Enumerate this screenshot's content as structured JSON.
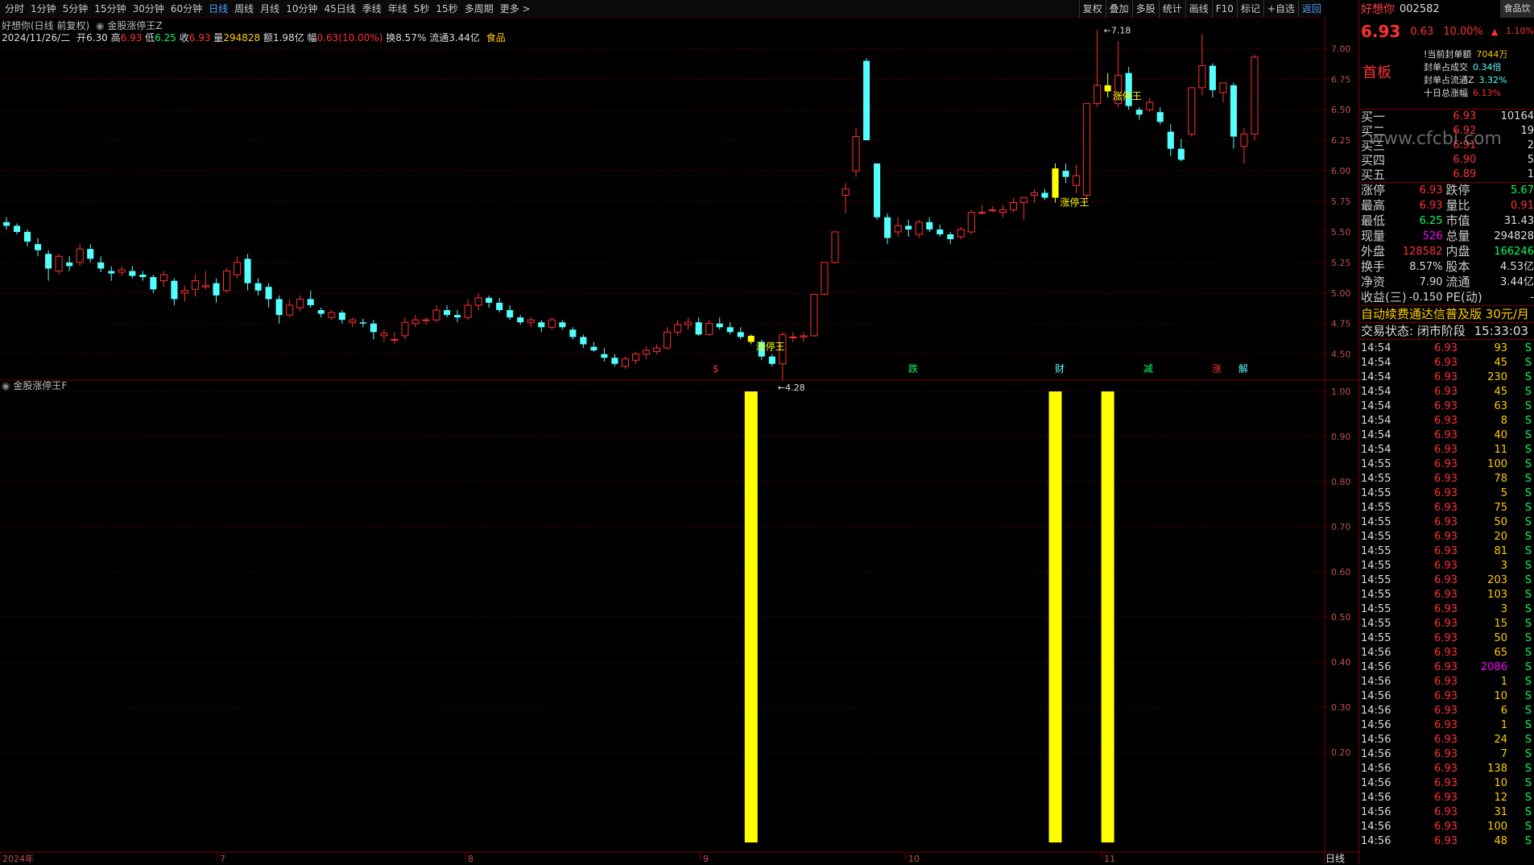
{
  "toolbar": {
    "periods": [
      "分时",
      "1分钟",
      "5分钟",
      "15分钟",
      "30分钟",
      "60分钟",
      "日线",
      "周线",
      "月线",
      "10分钟",
      "45日线",
      "季线",
      "年线",
      "5秒",
      "15秒",
      "多周期",
      "更多 >"
    ],
    "active": "日线",
    "tools": [
      "复权",
      "叠加",
      "多股",
      "统计",
      "画线",
      "F10",
      "标记",
      "+自选",
      "返回"
    ]
  },
  "header": {
    "title_line": "好想你(日线 前复权)",
    "indicator_main": "金股涨停王Z",
    "date": "2024/11/26/二",
    "open_label": "开",
    "open": "6.30",
    "high_label": "高",
    "high": "6.93",
    "low_label": "低",
    "low": "6.25",
    "close_label": "收",
    "close": "6.93",
    "vol_label": "量",
    "vol": "294828",
    "amt_label": "额",
    "amt": "1.98亿",
    "chg_label": "幅",
    "chg": "0.63(10.00%)",
    "turn_label": "换",
    "turn": "8.57%",
    "float_label": "流通",
    "float": "3.44亿",
    "sector": "食品"
  },
  "sub_indicator": "金股涨停王F",
  "colors": {
    "up": "#ff3030",
    "down": "#54ffff",
    "signal": "#ffff00",
    "grid": "#5a0000",
    "bg": "#000000"
  },
  "chart_data": {
    "type": "candlestick",
    "ylim": [
      4.3,
      7.2
    ],
    "yticks": [
      "7.00",
      "6.75",
      "6.50",
      "6.25",
      "6.00",
      "5.75",
      "5.50",
      "5.25",
      "5.00",
      "4.75",
      "4.50"
    ],
    "x_labels": [
      "2024年",
      "7",
      "8",
      "9",
      "10",
      "11"
    ],
    "annotations": {
      "high_mark": "7.18",
      "low_mark": "4.28",
      "signal_label": "涨停王"
    },
    "event_labels": [
      "$",
      "跌",
      "财",
      "减",
      "涨",
      "解"
    ],
    "candles": [
      [
        5.58,
        5.62,
        5.52,
        5.55
      ],
      [
        5.55,
        5.57,
        5.48,
        5.5
      ],
      [
        5.5,
        5.52,
        5.38,
        5.42
      ],
      [
        5.4,
        5.45,
        5.3,
        5.35
      ],
      [
        5.32,
        5.35,
        5.1,
        5.2
      ],
      [
        5.18,
        5.32,
        5.15,
        5.3
      ],
      [
        5.25,
        5.3,
        5.18,
        5.22
      ],
      [
        5.25,
        5.4,
        5.22,
        5.36
      ],
      [
        5.36,
        5.4,
        5.25,
        5.28
      ],
      [
        5.25,
        5.3,
        5.17,
        5.2
      ],
      [
        5.18,
        5.22,
        5.1,
        5.16
      ],
      [
        5.17,
        5.22,
        5.14,
        5.19
      ],
      [
        5.18,
        5.22,
        5.12,
        5.14
      ],
      [
        5.15,
        5.18,
        5.1,
        5.13
      ],
      [
        5.13,
        5.15,
        5.0,
        5.03
      ],
      [
        5.1,
        5.18,
        5.05,
        5.15
      ],
      [
        5.1,
        5.12,
        4.9,
        4.95
      ],
      [
        5.0,
        5.06,
        4.93,
        5.02
      ],
      [
        5.03,
        5.15,
        4.97,
        5.1
      ],
      [
        5.05,
        5.18,
        5.03,
        5.06
      ],
      [
        5.08,
        5.12,
        4.92,
        4.98
      ],
      [
        5.02,
        5.2,
        5.0,
        5.18
      ],
      [
        5.15,
        5.3,
        5.12,
        5.25
      ],
      [
        5.28,
        5.32,
        5.02,
        5.08
      ],
      [
        5.08,
        5.12,
        4.98,
        5.02
      ],
      [
        5.05,
        5.08,
        4.88,
        4.95
      ],
      [
        4.95,
        4.98,
        4.75,
        4.82
      ],
      [
        4.82,
        4.95,
        4.8,
        4.9
      ],
      [
        4.88,
        4.98,
        4.85,
        4.95
      ],
      [
        4.95,
        5.02,
        4.88,
        4.9
      ],
      [
        4.86,
        4.88,
        4.8,
        4.83
      ],
      [
        4.8,
        4.86,
        4.78,
        4.84
      ],
      [
        4.84,
        4.86,
        4.75,
        4.78
      ],
      [
        4.76,
        4.8,
        4.72,
        4.78
      ],
      [
        4.76,
        4.79,
        4.72,
        4.75
      ],
      [
        4.75,
        4.78,
        4.62,
        4.68
      ],
      [
        4.65,
        4.7,
        4.6,
        4.67
      ],
      [
        4.62,
        4.68,
        4.58,
        4.62
      ],
      [
        4.65,
        4.8,
        4.62,
        4.76
      ],
      [
        4.75,
        4.82,
        4.72,
        4.78
      ],
      [
        4.78,
        4.8,
        4.74,
        4.78
      ],
      [
        4.78,
        4.9,
        4.76,
        4.86
      ],
      [
        4.86,
        4.9,
        4.8,
        4.82
      ],
      [
        4.82,
        4.86,
        4.76,
        4.8
      ],
      [
        4.8,
        4.95,
        4.78,
        4.9
      ],
      [
        4.9,
        5.0,
        4.86,
        4.96
      ],
      [
        4.96,
        4.98,
        4.88,
        4.92
      ],
      [
        4.92,
        4.96,
        4.84,
        4.86
      ],
      [
        4.86,
        4.9,
        4.78,
        4.8
      ],
      [
        4.8,
        4.82,
        4.74,
        4.76
      ],
      [
        4.76,
        4.8,
        4.72,
        4.78
      ],
      [
        4.76,
        4.78,
        4.68,
        4.72
      ],
      [
        4.72,
        4.8,
        4.7,
        4.78
      ],
      [
        4.76,
        4.78,
        4.7,
        4.72
      ],
      [
        4.7,
        4.72,
        4.62,
        4.64
      ],
      [
        4.64,
        4.66,
        4.55,
        4.58
      ],
      [
        4.56,
        4.6,
        4.52,
        4.53
      ],
      [
        4.5,
        4.55,
        4.44,
        4.47
      ],
      [
        4.47,
        4.5,
        4.4,
        4.42
      ],
      [
        4.4,
        4.48,
        4.38,
        4.46
      ],
      [
        4.45,
        4.52,
        4.42,
        4.5
      ],
      [
        4.5,
        4.56,
        4.46,
        4.53
      ],
      [
        4.52,
        4.58,
        4.5,
        4.55
      ],
      [
        4.55,
        4.72,
        4.54,
        4.68
      ],
      [
        4.68,
        4.78,
        4.65,
        4.74
      ],
      [
        4.74,
        4.8,
        4.7,
        4.76
      ],
      [
        4.76,
        4.8,
        4.65,
        4.66
      ],
      [
        4.66,
        4.78,
        4.65,
        4.75
      ],
      [
        4.75,
        4.8,
        4.7,
        4.72
      ],
      [
        4.72,
        4.76,
        4.66,
        4.68
      ],
      [
        4.68,
        4.72,
        4.62,
        4.64
      ],
      [
        4.65,
        4.66,
        4.58,
        4.6
      ],
      [
        4.6,
        4.62,
        4.45,
        4.48
      ],
      [
        4.48,
        4.5,
        4.4,
        4.42
      ],
      [
        4.42,
        4.68,
        4.28,
        4.66
      ],
      [
        4.64,
        4.68,
        4.6,
        4.64
      ],
      [
        4.64,
        4.68,
        4.6,
        4.65
      ],
      [
        4.65,
        4.99,
        4.64,
        4.99
      ],
      [
        4.99,
        5.25,
        4.98,
        5.25
      ],
      [
        5.25,
        5.5,
        5.24,
        5.5
      ],
      [
        5.8,
        5.9,
        5.65,
        5.85
      ],
      [
        6.0,
        6.35,
        5.95,
        6.28
      ],
      [
        6.9,
        6.92,
        6.25,
        6.25
      ],
      [
        6.06,
        6.06,
        5.6,
        5.62
      ],
      [
        5.62,
        5.65,
        5.4,
        5.45
      ],
      [
        5.5,
        5.62,
        5.46,
        5.55
      ],
      [
        5.55,
        5.6,
        5.46,
        5.52
      ],
      [
        5.48,
        5.6,
        5.45,
        5.58
      ],
      [
        5.58,
        5.62,
        5.5,
        5.52
      ],
      [
        5.52,
        5.56,
        5.46,
        5.48
      ],
      [
        5.48,
        5.5,
        5.4,
        5.44
      ],
      [
        5.46,
        5.54,
        5.44,
        5.52
      ],
      [
        5.5,
        5.68,
        5.48,
        5.66
      ],
      [
        5.66,
        5.72,
        5.64,
        5.66
      ],
      [
        5.68,
        5.71,
        5.66,
        5.68
      ],
      [
        5.66,
        5.72,
        5.62,
        5.68
      ],
      [
        5.68,
        5.78,
        5.66,
        5.74
      ],
      [
        5.74,
        5.78,
        5.6,
        5.78
      ],
      [
        5.8,
        5.85,
        5.74,
        5.82
      ],
      [
        5.82,
        5.85,
        5.76,
        5.78
      ],
      [
        5.78,
        6.06,
        5.74,
        6.02
      ],
      [
        6.0,
        6.06,
        5.9,
        5.95
      ],
      [
        5.88,
        6.05,
        5.82,
        5.96
      ],
      [
        5.8,
        6.55,
        5.75,
        6.55
      ],
      [
        6.55,
        7.15,
        6.52,
        6.7
      ],
      [
        6.7,
        6.8,
        6.6,
        6.65
      ],
      [
        6.55,
        7.06,
        6.52,
        6.78
      ],
      [
        6.8,
        6.85,
        6.5,
        6.53
      ],
      [
        6.5,
        6.52,
        6.42,
        6.46
      ],
      [
        6.5,
        6.6,
        6.48,
        6.56
      ],
      [
        6.48,
        6.52,
        6.38,
        6.4
      ],
      [
        6.32,
        6.38,
        6.12,
        6.18
      ],
      [
        6.18,
        6.26,
        6.08,
        6.09
      ],
      [
        6.3,
        6.68,
        6.28,
        6.68
      ],
      [
        6.68,
        7.12,
        6.62,
        6.86
      ],
      [
        6.86,
        6.88,
        6.6,
        6.66
      ],
      [
        6.64,
        6.68,
        6.56,
        6.72
      ],
      [
        6.7,
        6.72,
        6.18,
        6.28
      ],
      [
        6.2,
        6.35,
        6.06,
        6.3
      ],
      [
        6.3,
        6.95,
        6.25,
        6.93
      ]
    ],
    "signal_days": [
      71,
      100,
      105
    ],
    "signal_bars": [
      72,
      107,
      112
    ],
    "signal_ylim": [
      0,
      1.0
    ],
    "signal_yticks": [
      "1.00",
      "0.90",
      "0.80",
      "0.70",
      "0.60",
      "0.50",
      "0.40",
      "0.30",
      "0.20"
    ]
  },
  "quote": {
    "name": "好想你",
    "code": "002582",
    "btn": "食品饮",
    "price": "6.93",
    "change": "0.63",
    "pct": "10.00%",
    "pct_side": "1.10%",
    "board": "首板",
    "seal": [
      {
        "k": "!当前封单额",
        "v": "7044万",
        "c": "#ffcc00"
      },
      {
        "k": "封单占成交",
        "v": "0.34倍",
        "c": "#54ffff"
      },
      {
        "k": "封单占流通Z",
        "v": "3.32%",
        "c": "#54ffff"
      },
      {
        "k": "十日总涨幅",
        "v": "6.13%",
        "c": "#ff3030"
      }
    ],
    "book": [
      {
        "l": "买一",
        "p": "6.93",
        "v": "10164"
      },
      {
        "l": "买二",
        "p": "6.92",
        "v": "19"
      },
      {
        "l": "买三",
        "p": "6.91",
        "v": "2"
      },
      {
        "l": "买四",
        "p": "6.90",
        "v": "5"
      },
      {
        "l": "买五",
        "p": "6.89",
        "v": "1"
      }
    ],
    "stats": [
      {
        "l1": "涨停",
        "v1": "6.93",
        "c1": "#ff3030",
        "l2": "跌停",
        "v2": "5.67",
        "c2": "#00ff60"
      },
      {
        "l1": "最高",
        "v1": "6.93",
        "c1": "#ff3030",
        "l2": "量比",
        "v2": "0.91",
        "c2": "#ff3030"
      },
      {
        "l1": "最低",
        "v1": "6.25",
        "c1": "#00ff60",
        "l2": "市值",
        "v2": "31.43",
        "c2": "#dddddd"
      },
      {
        "l1": "现量",
        "v1": "526",
        "c1": "#ff00ff",
        "l2": "总量",
        "v2": "294828",
        "c2": "#dddddd"
      },
      {
        "l1": "外盘",
        "v1": "128582",
        "c1": "#ff3030",
        "l2": "内盘",
        "v2": "166246",
        "c2": "#00ff60"
      },
      {
        "l1": "换手",
        "v1": "8.57%",
        "c1": "#dddddd",
        "l2": "股本",
        "v2": "4.53亿",
        "c2": "#dddddd"
      },
      {
        "l1": "净资",
        "v1": "7.90",
        "c1": "#dddddd",
        "l2": "流通",
        "v2": "3.44亿",
        "c2": "#dddddd"
      },
      {
        "l1": "收益(三)",
        "v1": "-0.150",
        "c1": "#dddddd",
        "l2": "PE(动)",
        "v2": "-",
        "c2": "#dddddd"
      }
    ],
    "ad": "自动续费通达信普及版  30元/月",
    "trade_state": "交易状态: 闭市阶段",
    "trade_time": "15:33:03",
    "watermark": "www.cfcbi.com",
    "ticks": [
      [
        "14:54",
        "6.93",
        "93"
      ],
      [
        "14:54",
        "6.93",
        "45"
      ],
      [
        "14:54",
        "6.93",
        "230"
      ],
      [
        "14:54",
        "6.93",
        "45"
      ],
      [
        "14:54",
        "6.93",
        "63"
      ],
      [
        "14:54",
        "6.93",
        "8"
      ],
      [
        "14:54",
        "6.93",
        "40"
      ],
      [
        "14:54",
        "6.93",
        "11"
      ],
      [
        "14:55",
        "6.93",
        "100"
      ],
      [
        "14:55",
        "6.93",
        "78"
      ],
      [
        "14:55",
        "6.93",
        "5"
      ],
      [
        "14:55",
        "6.93",
        "75"
      ],
      [
        "14:55",
        "6.93",
        "50"
      ],
      [
        "14:55",
        "6.93",
        "20"
      ],
      [
        "14:55",
        "6.93",
        "81"
      ],
      [
        "14:55",
        "6.93",
        "3"
      ],
      [
        "14:55",
        "6.93",
        "203"
      ],
      [
        "14:55",
        "6.93",
        "103"
      ],
      [
        "14:55",
        "6.93",
        "3"
      ],
      [
        "14:55",
        "6.93",
        "15"
      ],
      [
        "14:55",
        "6.93",
        "50"
      ],
      [
        "14:56",
        "6.93",
        "65"
      ],
      [
        "14:56",
        "6.93",
        "2086"
      ],
      [
        "14:56",
        "6.93",
        "1"
      ],
      [
        "14:56",
        "6.93",
        "10"
      ],
      [
        "14:56",
        "6.93",
        "6"
      ],
      [
        "14:56",
        "6.93",
        "1"
      ],
      [
        "14:56",
        "6.93",
        "24"
      ],
      [
        "14:56",
        "6.93",
        "7"
      ],
      [
        "14:56",
        "6.93",
        "138"
      ],
      [
        "14:56",
        "6.93",
        "10"
      ],
      [
        "14:56",
        "6.93",
        "12"
      ],
      [
        "14:56",
        "6.93",
        "31"
      ],
      [
        "14:56",
        "6.93",
        "100"
      ],
      [
        "14:56",
        "6.93",
        "48"
      ]
    ],
    "tick_side": "S"
  },
  "footer": {
    "period_label": "日线"
  }
}
